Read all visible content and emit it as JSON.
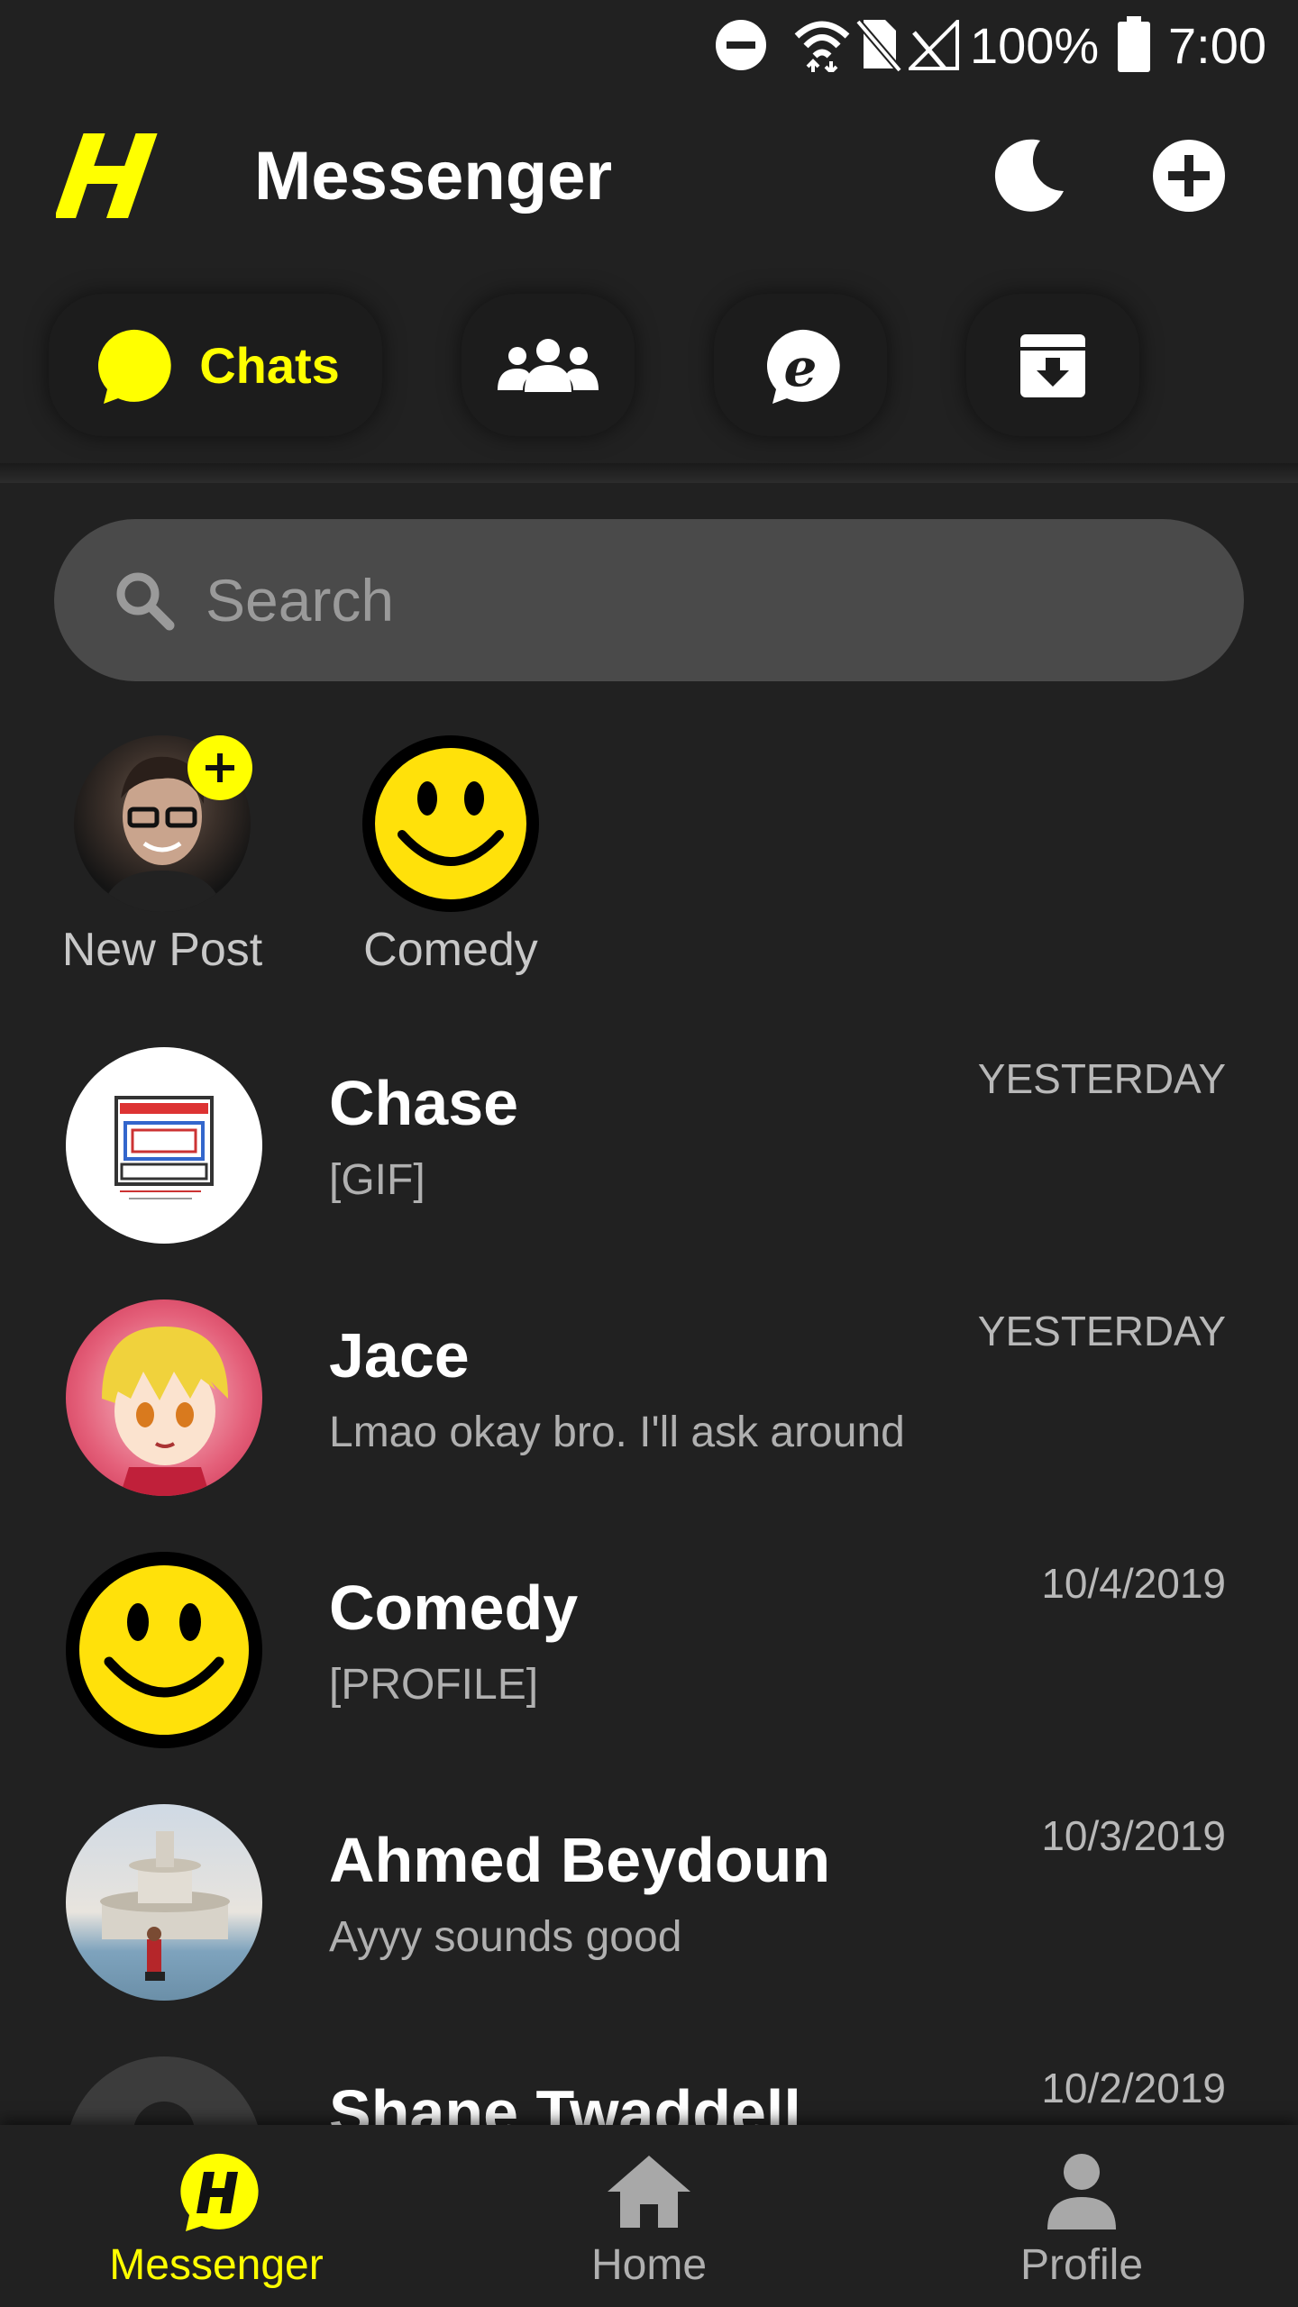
{
  "status_bar": {
    "battery": "100%",
    "time": "7:00"
  },
  "header": {
    "title": "Messenger"
  },
  "tabs": {
    "chats_label": "Chats"
  },
  "search": {
    "placeholder": "Search"
  },
  "stories": [
    {
      "label": "New Post"
    },
    {
      "label": "Comedy"
    }
  ],
  "chats": [
    {
      "name": "Chase",
      "preview": "[GIF]",
      "time": "YESTERDAY"
    },
    {
      "name": "Jace",
      "preview": "Lmao okay bro. I'll ask around",
      "time": "YESTERDAY"
    },
    {
      "name": "Comedy",
      "preview": "[PROFILE]",
      "time": "10/4/2019"
    },
    {
      "name": "Ahmed Beydoun",
      "preview": "Ayyy sounds good",
      "time": "10/3/2019"
    },
    {
      "name": "Shane Twaddell",
      "preview": "",
      "time": "10/2/2019"
    }
  ],
  "bottom_nav": [
    {
      "label": "Messenger",
      "active": true
    },
    {
      "label": "Home",
      "active": false
    },
    {
      "label": "Profile",
      "active": false
    }
  ],
  "colors": {
    "accent": "#ffff00",
    "background": "#212121",
    "search_bg": "#4a4a4a"
  }
}
